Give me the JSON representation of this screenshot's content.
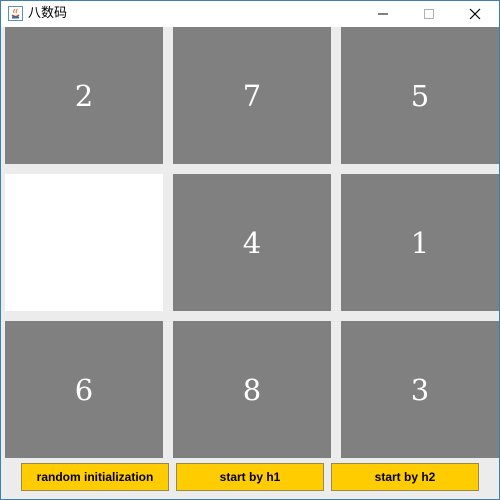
{
  "window": {
    "title": "八数码",
    "icon": "java-icon",
    "controls": [
      "minimize-icon",
      "maximize-icon",
      "close-icon"
    ]
  },
  "board": {
    "tiles": [
      "2",
      "7",
      "5",
      "",
      "4",
      "1",
      "6",
      "8",
      "3"
    ],
    "colors": {
      "tile": "#808080",
      "blank": "#ffffff",
      "background": "#ececec"
    }
  },
  "buttons": {
    "random": "random initialization",
    "h1": "start by h1",
    "h2": "start by h2",
    "color": "#ffcc00"
  }
}
